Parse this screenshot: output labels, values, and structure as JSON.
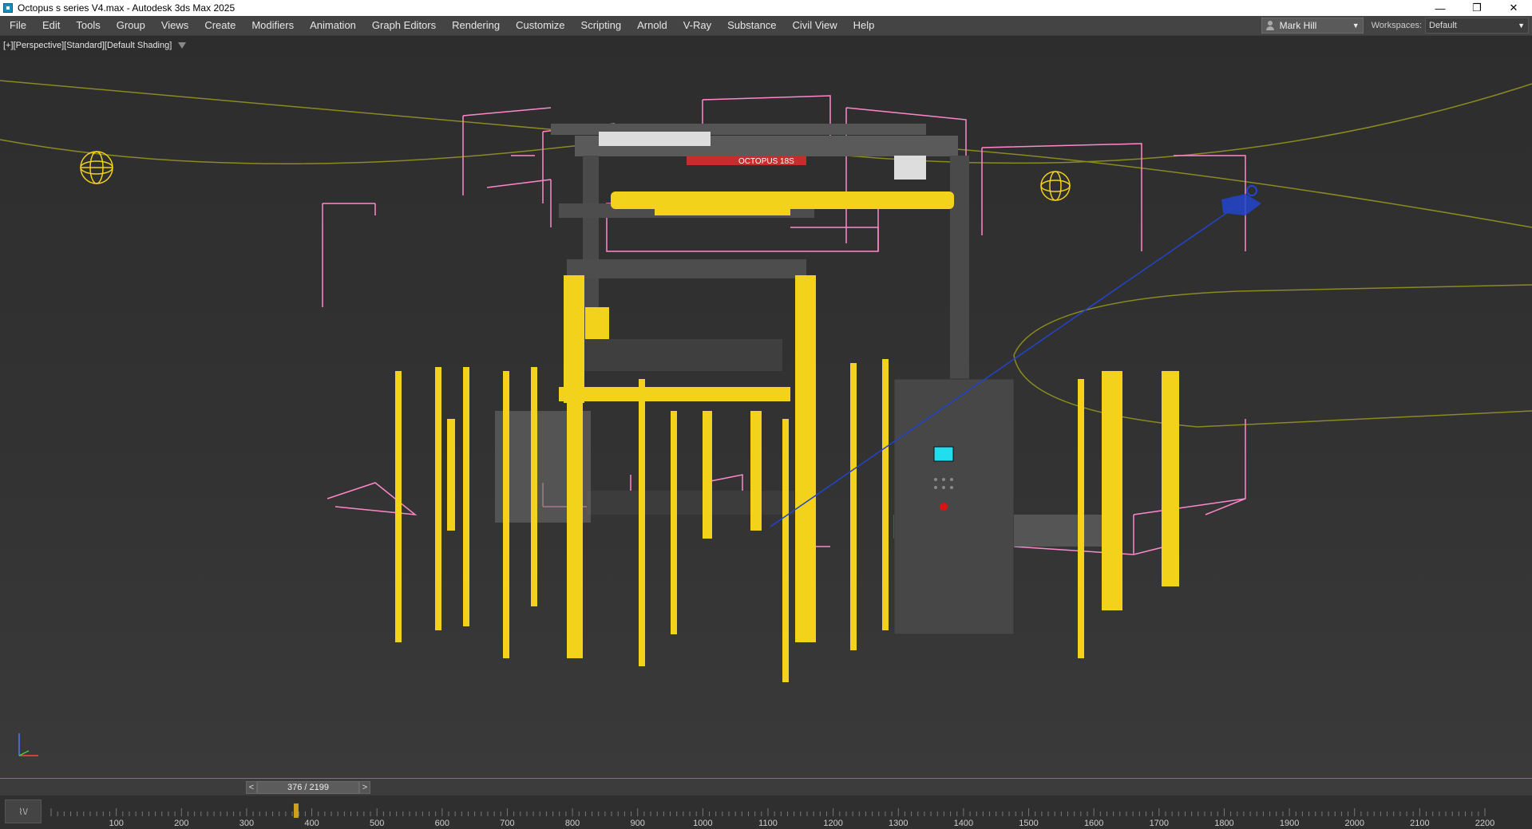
{
  "window": {
    "title": "Octopus s series V4.max - Autodesk 3ds Max 2025",
    "controls": [
      "—",
      "❐",
      "✕"
    ]
  },
  "menu": {
    "items": [
      "File",
      "Edit",
      "Tools",
      "Group",
      "Views",
      "Create",
      "Modifiers",
      "Animation",
      "Graph Editors",
      "Rendering",
      "Customize",
      "Scripting",
      "Arnold",
      "V-Ray",
      "Substance",
      "Civil View",
      "Help"
    ],
    "user": "Mark Hill",
    "workspaces_label": "Workspaces:",
    "workspace_value": "Default"
  },
  "viewport": {
    "labels": [
      "[+]",
      "[Perspective]",
      "[Standard]",
      "[Default Shading]"
    ],
    "machine_label": "OCTOPUS 18S",
    "colors": {
      "frame_yellow": "#f2d21a",
      "body_gray": "#4a4a4a",
      "helper_pink": "#ff88cc",
      "path_olive": "#8a8a22",
      "camera_blue": "#2244cc",
      "screen_cyan": "#22ddee",
      "estop_red": "#dd1111"
    }
  },
  "timeslider": {
    "prev": "<",
    "next": ">",
    "frame_display": "376 / 2199",
    "current_frame": 376,
    "total_frames": 2199
  },
  "trackbar": {
    "curve_button": "⌇\\/",
    "ticks": [
      "100",
      "200",
      "300",
      "400",
      "500",
      "600",
      "700",
      "800",
      "900",
      "1000",
      "1100",
      "1200",
      "1300",
      "1400",
      "1500",
      "1600",
      "1700",
      "1800",
      "1900",
      "2000",
      "2100",
      "2200"
    ]
  }
}
